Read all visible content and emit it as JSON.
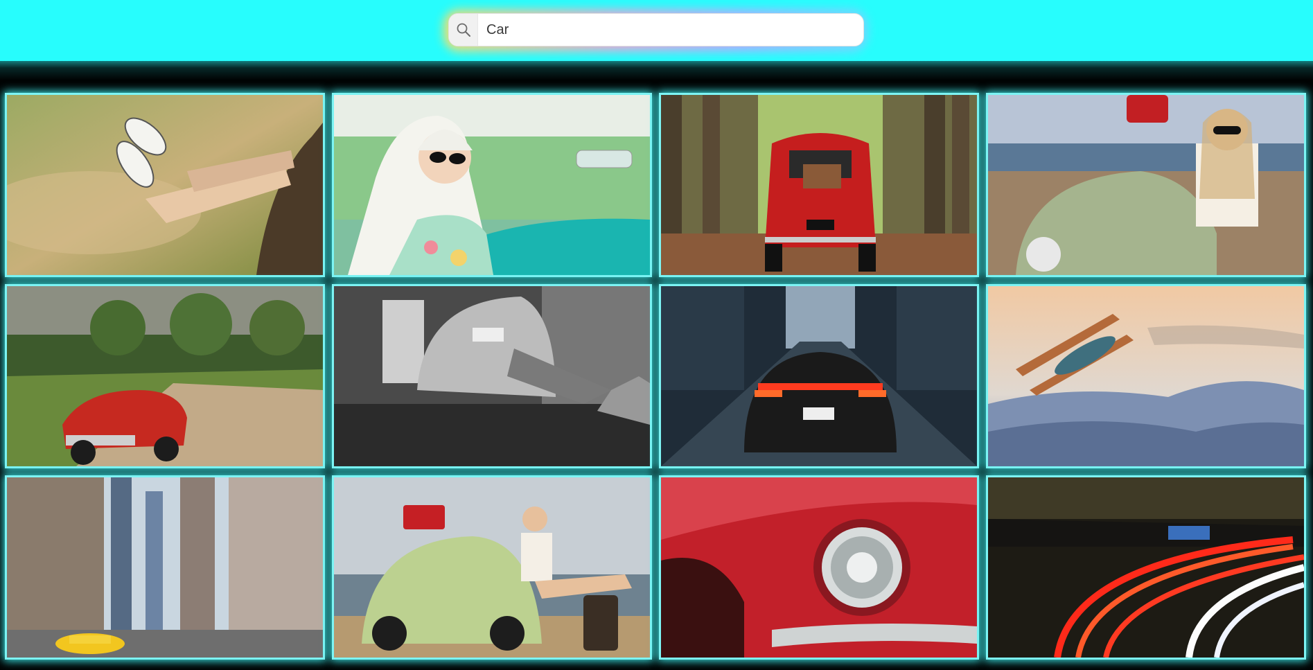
{
  "search": {
    "value": "Car",
    "icon": "search-icon"
  },
  "colors": {
    "header": "#27fdfd",
    "tile_glow": "#3be6e6",
    "background": "#010303"
  },
  "gallery": {
    "images": [
      {
        "name": "feet-out-car-window"
      },
      {
        "name": "woman-driving-vintage-car"
      },
      {
        "name": "red-fiat-in-forest"
      },
      {
        "name": "woman-with-green-beetle-beach"
      },
      {
        "name": "red-convertible-country-road"
      },
      {
        "name": "man-repairing-beetle-bw"
      },
      {
        "name": "porsche-city-street-night"
      },
      {
        "name": "biplane-over-mountains"
      },
      {
        "name": "new-york-street-taxi"
      },
      {
        "name": "woman-sitting-on-beetle"
      },
      {
        "name": "red-car-headlight-closeup"
      },
      {
        "name": "highway-light-trails"
      }
    ]
  }
}
